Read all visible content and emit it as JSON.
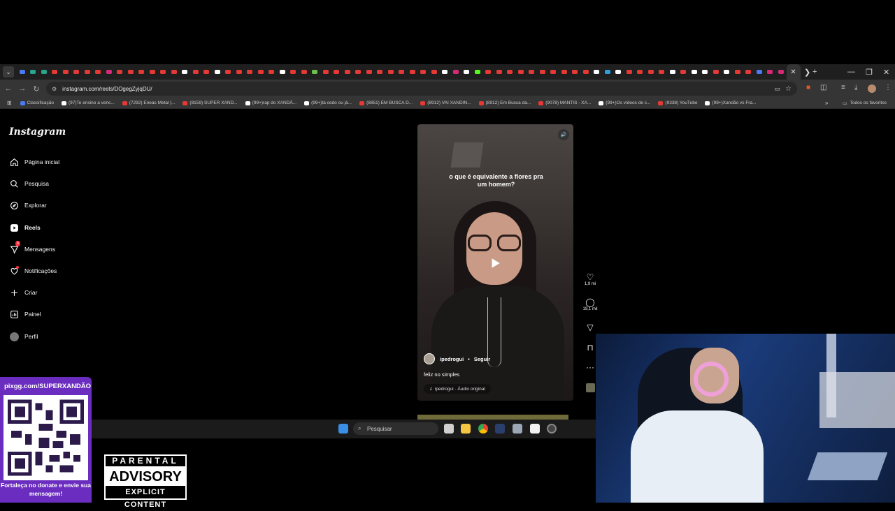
{
  "browser": {
    "url": "instagram.com/reels/DOgegZyjqDU/",
    "tab_colors": [
      "#4a7bf5",
      "#2aa58a",
      "#2aa58a",
      "#e53935",
      "#e53935",
      "#e53935",
      "#e53935",
      "#e53935",
      "#d62976",
      "#e53935",
      "#e53935",
      "#e53935",
      "#e53935",
      "#e53935",
      "#e53935",
      "#ffffff",
      "#e53935",
      "#e53935",
      "#ffffff",
      "#e53935",
      "#e53935",
      "#e53935",
      "#e53935",
      "#e53935",
      "#ffffff",
      "#e53935",
      "#e53935",
      "#6cc04a",
      "#e53935",
      "#e53935",
      "#e53935",
      "#e53935",
      "#e53935",
      "#e53935",
      "#e53935",
      "#e53935",
      "#e53935",
      "#e53935",
      "#e53935",
      "#ffffff",
      "#d62976",
      "#ffffff",
      "#53fc18",
      "#e53935",
      "#e53935",
      "#e53935",
      "#e53935",
      "#e53935",
      "#e53935",
      "#e53935",
      "#e53935",
      "#e53935",
      "#e53935",
      "#ffffff",
      "#2aa1de",
      "#ffffff",
      "#e53935",
      "#e53935",
      "#e53935",
      "#e53935",
      "#ffffff",
      "#e53935",
      "#ffffff",
      "#ffffff",
      "#e53935",
      "#ffffff",
      "#e53935",
      "#e53935",
      "#4a7bf5",
      "#d62976",
      "#d62976"
    ],
    "bookmarks": [
      {
        "label": "Classificação",
        "color": "#4a7bf5"
      },
      {
        "label": "(97)Te ensino a venc...",
        "color": "#ffffff"
      },
      {
        "label": "(7292) Eneas Metal |...",
        "color": "#e53935"
      },
      {
        "label": "(8159) SUPER XAND...",
        "color": "#e53935"
      },
      {
        "label": "(99+)rap do XANDÃ...",
        "color": "#ffffff"
      },
      {
        "label": "(99+)tá cedo ou já...",
        "color": "#ffffff"
      },
      {
        "label": "(8851) EM BUSCA D...",
        "color": "#e53935"
      },
      {
        "label": "(8912) VAI XANDIN...",
        "color": "#e53935"
      },
      {
        "label": "(8912) Em Busca da...",
        "color": "#e53935"
      },
      {
        "label": "(9078) MANTIS - XA...",
        "color": "#e53935"
      },
      {
        "label": "(99+)Os vídeos de c...",
        "color": "#ffffff"
      },
      {
        "label": "(9338) YouTube",
        "color": "#e53935"
      },
      {
        "label": "(99+)Xandão vs Fra...",
        "color": "#ffffff"
      }
    ],
    "all_bookmarks": "Todos os favoritos"
  },
  "instagram": {
    "logo": "Instagram",
    "nav": [
      {
        "label": "Página inicial",
        "icon": "home-icon"
      },
      {
        "label": "Pesquisa",
        "icon": "search-icon"
      },
      {
        "label": "Explorar",
        "icon": "compass-icon"
      },
      {
        "label": "Reels",
        "icon": "reels-icon"
      },
      {
        "label": "Mensagens",
        "icon": "messenger-icon",
        "badge": "9"
      },
      {
        "label": "Notificações",
        "icon": "heart-icon"
      },
      {
        "label": "Criar",
        "icon": "plus-icon"
      },
      {
        "label": "Painel",
        "icon": "chart-icon"
      },
      {
        "label": "Perfil",
        "icon": "avatar-icon"
      }
    ],
    "reel": {
      "caption_overlay": "o que é equivalente a flores pra um homem?",
      "author": "ipedrogui",
      "separator": "•",
      "follow": "Seguir",
      "description": "feliz no simples",
      "audio": "ipedrogui · Áudio original"
    },
    "actions": {
      "likes": "1,9 mi",
      "comments": "19,1 mil"
    }
  },
  "taskbar": {
    "search_placeholder": "Pesquisar"
  },
  "overlay": {
    "pix_url": "pixgg.com/SUPERXANDÃO",
    "pix_message": "Fortaleça no donate e envie sua mensagem!",
    "advisory": {
      "line1": "PARENTAL",
      "line2": "ADVISORY",
      "line3": "EXPLICIT CONTENT"
    }
  }
}
